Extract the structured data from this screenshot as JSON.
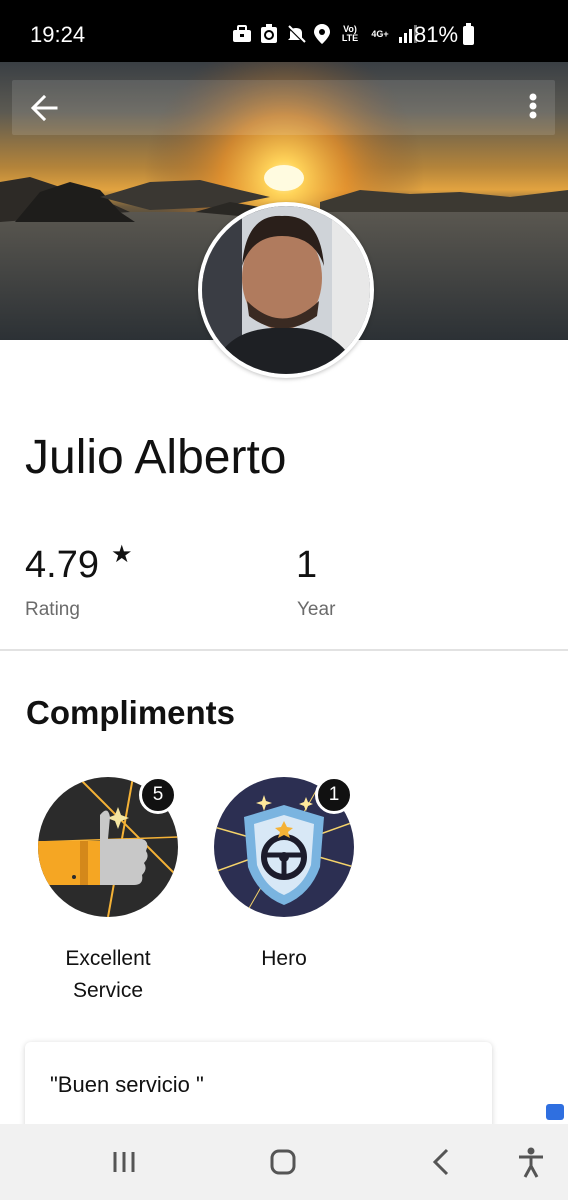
{
  "status_bar": {
    "time": "19:24",
    "battery": "81%",
    "volte_label": "Vo) LTE",
    "network_label": "4G+",
    "icons": [
      "briefcase-icon",
      "recycle-icon",
      "mute-icon",
      "location-icon",
      "volte-icon",
      "network-4g-icon",
      "signal-icon",
      "battery-icon"
    ]
  },
  "header": {
    "back_icon": "arrow-left-icon",
    "menu_icon": "more-vertical-icon"
  },
  "profile": {
    "name": "Julio Alberto",
    "stats": [
      {
        "value": "4.79",
        "label": "Rating",
        "icon": "star-icon"
      },
      {
        "value": "1",
        "label": "Year"
      }
    ]
  },
  "compliments": {
    "title": "Compliments",
    "items": [
      {
        "label_line1": "Excellent",
        "label_line2": "Service",
        "count": "5",
        "icon": "thumbs-up-icon"
      },
      {
        "label_line1": "Hero",
        "count": "1",
        "icon": "hero-shield-icon"
      }
    ]
  },
  "reviews": [
    {
      "text": "\"Buen servicio \""
    }
  ],
  "nav_bar": {
    "icons": [
      "recent-apps-icon",
      "home-icon",
      "back-icon",
      "accessibility-icon"
    ]
  },
  "colors": {
    "accent_gold": "#f5b236",
    "badge_dark": "#2b2b2b",
    "hero_bg": "#2c2f52",
    "count_badge": "#111111"
  }
}
